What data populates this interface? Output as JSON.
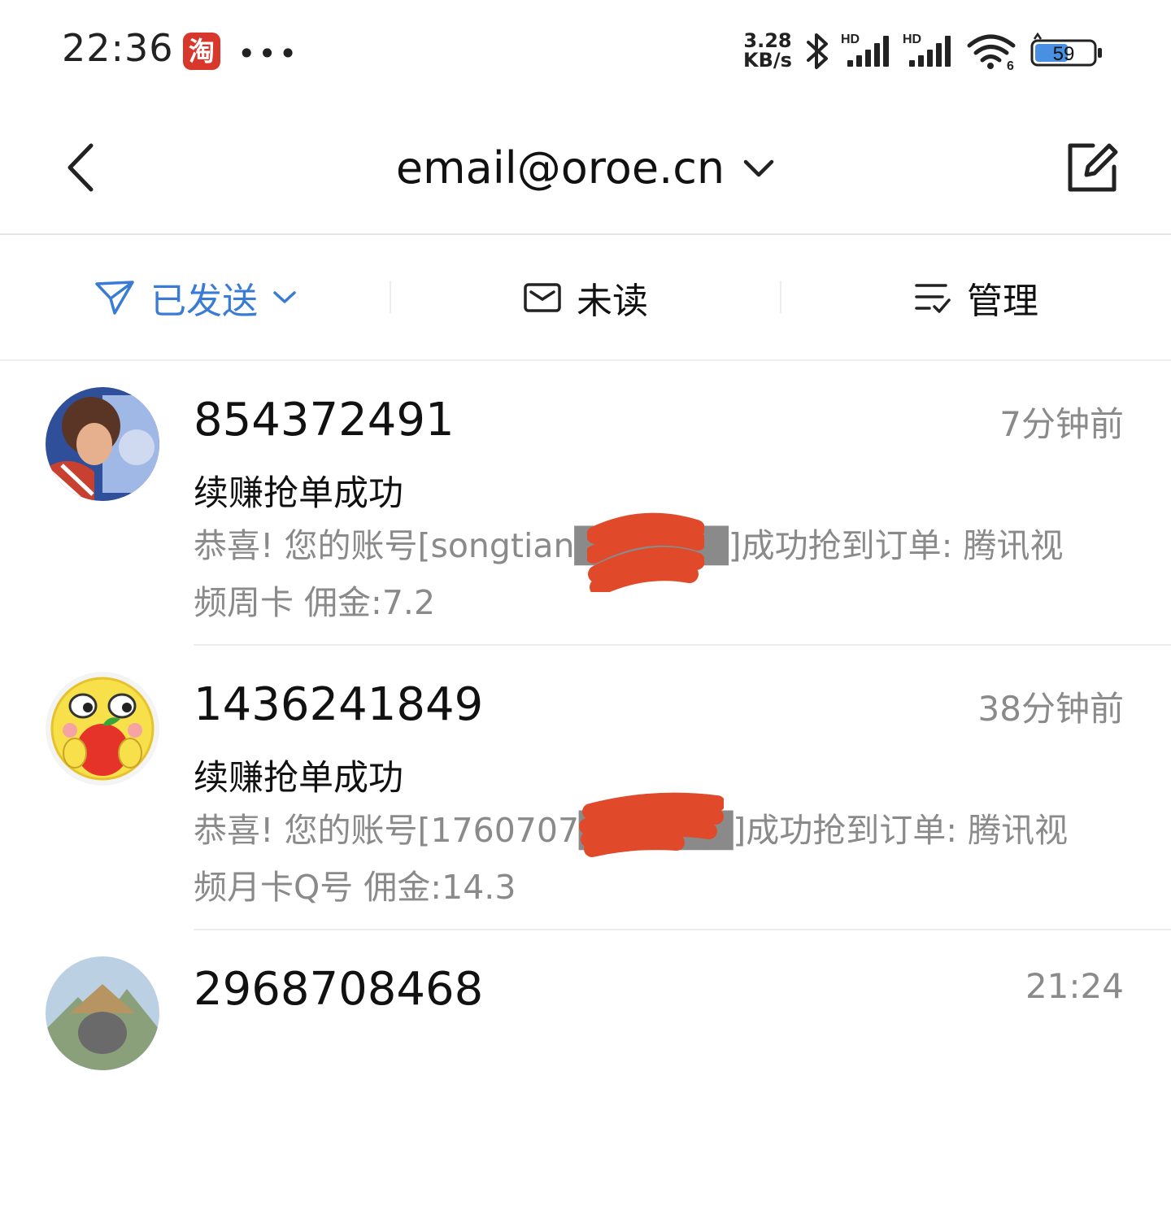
{
  "status_bar": {
    "time": "22:36",
    "app_icon_char": "淘",
    "more": "•••",
    "net_speed_value": "3.28",
    "net_speed_unit": "KB/s",
    "signal_label_1": "HD",
    "signal_label_2": "HD",
    "wifi_label": "6",
    "battery_level": "59",
    "icons": [
      "taobao-app-icon",
      "bluetooth-icon",
      "signal-icon",
      "signal-icon",
      "wifi-icon",
      "battery-icon"
    ]
  },
  "header": {
    "account": "email@oroe.cn",
    "icons": [
      "back-arrow-icon",
      "chevron-down-icon",
      "compose-icon"
    ]
  },
  "filters": {
    "folder_label": "已发送",
    "unread_label": "未读",
    "manage_label": "管理",
    "accent_color": "#3a7bd5"
  },
  "mails": [
    {
      "sender": "854372491",
      "time": "7分钟前",
      "subject": "续赚抢单成功",
      "preview": "恭喜! 您的账号[songtian██████]成功抢到订单: 腾讯视频周卡 佣金:7.2"
    },
    {
      "sender": "1436241849",
      "time": "38分钟前",
      "subject": "续赚抢单成功",
      "preview": "恭喜! 您的账号[1760707██████]成功抢到订单: 腾讯视频月卡Q号 佣金:14.3"
    },
    {
      "sender": "2968708468",
      "time": "21:24",
      "subject": "",
      "preview": ""
    }
  ]
}
